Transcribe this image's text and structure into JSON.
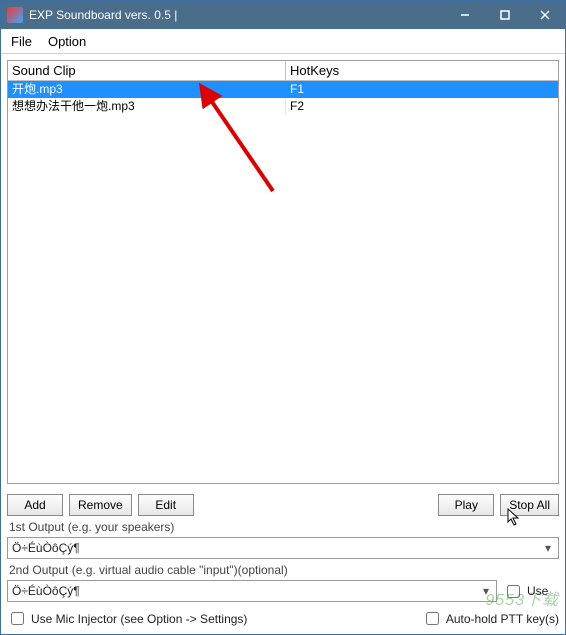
{
  "window": {
    "title": "EXP Soundboard vers. 0.5 |"
  },
  "menubar": {
    "file": "File",
    "option": "Option"
  },
  "table": {
    "headers": {
      "sound": "Sound Clip",
      "hotkeys": "HotKeys"
    },
    "rows": [
      {
        "sound": "开炮.mp3",
        "hotkey": "F1",
        "selected": true
      },
      {
        "sound": "想想办法干他一炮.mp3",
        "hotkey": "F2",
        "selected": false
      }
    ]
  },
  "buttons": {
    "add": "Add",
    "remove": "Remove",
    "edit": "Edit",
    "play": "Play",
    "stop_all": "Stop All"
  },
  "outputs": {
    "label1": "1st Output (e.g. your speakers)",
    "value1": "Ö÷ÉùÒôÇý¶",
    "label2": "2nd Output (e.g. virtual audio cable \"input\")(optional)",
    "value2": "Ö÷ÉùÒôÇý¶",
    "use_label": "Use"
  },
  "checkboxes": {
    "mic_injector": "Use Mic Injector (see Option -> Settings)",
    "auto_hold": "Auto-hold PTT key(s)"
  },
  "watermark": "9553下载"
}
